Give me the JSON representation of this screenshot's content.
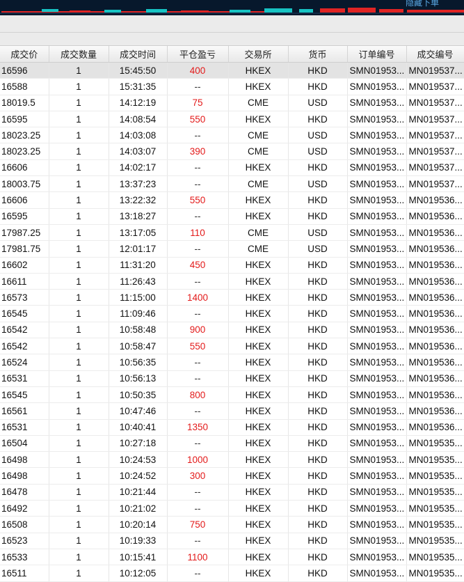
{
  "topbar": {
    "hide_label": "隐藏下单"
  },
  "table": {
    "headers": [
      "成交价",
      "成交数量",
      "成交时间",
      "平仓盈亏",
      "交易所",
      "货币",
      "订单编号",
      "成交编号"
    ],
    "rows": [
      {
        "price": "16596",
        "qty": "1",
        "time": "15:45:50",
        "pnl": "400",
        "exchange": "HKEX",
        "currency": "HKD",
        "order": "SMN01953...",
        "trade": "MN019537...",
        "selected": true
      },
      {
        "price": "16588",
        "qty": "1",
        "time": "15:31:35",
        "pnl": "--",
        "exchange": "HKEX",
        "currency": "HKD",
        "order": "SMN01953...",
        "trade": "MN019537..."
      },
      {
        "price": "18019.5",
        "qty": "1",
        "time": "14:12:19",
        "pnl": "75",
        "exchange": "CME",
        "currency": "USD",
        "order": "SMN01953...",
        "trade": "MN019537..."
      },
      {
        "price": "16595",
        "qty": "1",
        "time": "14:08:54",
        "pnl": "550",
        "exchange": "HKEX",
        "currency": "HKD",
        "order": "SMN01953...",
        "trade": "MN019537..."
      },
      {
        "price": "18023.25",
        "qty": "1",
        "time": "14:03:08",
        "pnl": "--",
        "exchange": "CME",
        "currency": "USD",
        "order": "SMN01953...",
        "trade": "MN019537..."
      },
      {
        "price": "18023.25",
        "qty": "1",
        "time": "14:03:07",
        "pnl": "390",
        "exchange": "CME",
        "currency": "USD",
        "order": "SMN01953...",
        "trade": "MN019537..."
      },
      {
        "price": "16606",
        "qty": "1",
        "time": "14:02:17",
        "pnl": "--",
        "exchange": "HKEX",
        "currency": "HKD",
        "order": "SMN01953...",
        "trade": "MN019537..."
      },
      {
        "price": "18003.75",
        "qty": "1",
        "time": "13:37:23",
        "pnl": "--",
        "exchange": "CME",
        "currency": "USD",
        "order": "SMN01953...",
        "trade": "MN019537..."
      },
      {
        "price": "16606",
        "qty": "1",
        "time": "13:22:32",
        "pnl": "550",
        "exchange": "HKEX",
        "currency": "HKD",
        "order": "SMN01953...",
        "trade": "MN019536..."
      },
      {
        "price": "16595",
        "qty": "1",
        "time": "13:18:27",
        "pnl": "--",
        "exchange": "HKEX",
        "currency": "HKD",
        "order": "SMN01953...",
        "trade": "MN019536..."
      },
      {
        "price": "17987.25",
        "qty": "1",
        "time": "13:17:05",
        "pnl": "110",
        "exchange": "CME",
        "currency": "USD",
        "order": "SMN01953...",
        "trade": "MN019536..."
      },
      {
        "price": "17981.75",
        "qty": "1",
        "time": "12:01:17",
        "pnl": "--",
        "exchange": "CME",
        "currency": "USD",
        "order": "SMN01953...",
        "trade": "MN019536..."
      },
      {
        "price": "16602",
        "qty": "1",
        "time": "11:31:20",
        "pnl": "450",
        "exchange": "HKEX",
        "currency": "HKD",
        "order": "SMN01953...",
        "trade": "MN019536..."
      },
      {
        "price": "16611",
        "qty": "1",
        "time": "11:26:43",
        "pnl": "--",
        "exchange": "HKEX",
        "currency": "HKD",
        "order": "SMN01953...",
        "trade": "MN019536..."
      },
      {
        "price": "16573",
        "qty": "1",
        "time": "11:15:00",
        "pnl": "1400",
        "exchange": "HKEX",
        "currency": "HKD",
        "order": "SMN01953...",
        "trade": "MN019536..."
      },
      {
        "price": "16545",
        "qty": "1",
        "time": "11:09:46",
        "pnl": "--",
        "exchange": "HKEX",
        "currency": "HKD",
        "order": "SMN01953...",
        "trade": "MN019536..."
      },
      {
        "price": "16542",
        "qty": "1",
        "time": "10:58:48",
        "pnl": "900",
        "exchange": "HKEX",
        "currency": "HKD",
        "order": "SMN01953...",
        "trade": "MN019536..."
      },
      {
        "price": "16542",
        "qty": "1",
        "time": "10:58:47",
        "pnl": "550",
        "exchange": "HKEX",
        "currency": "HKD",
        "order": "SMN01953...",
        "trade": "MN019536..."
      },
      {
        "price": "16524",
        "qty": "1",
        "time": "10:56:35",
        "pnl": "--",
        "exchange": "HKEX",
        "currency": "HKD",
        "order": "SMN01953...",
        "trade": "MN019536..."
      },
      {
        "price": "16531",
        "qty": "1",
        "time": "10:56:13",
        "pnl": "--",
        "exchange": "HKEX",
        "currency": "HKD",
        "order": "SMN01953...",
        "trade": "MN019536..."
      },
      {
        "price": "16545",
        "qty": "1",
        "time": "10:50:35",
        "pnl": "800",
        "exchange": "HKEX",
        "currency": "HKD",
        "order": "SMN01953...",
        "trade": "MN019536..."
      },
      {
        "price": "16561",
        "qty": "1",
        "time": "10:47:46",
        "pnl": "--",
        "exchange": "HKEX",
        "currency": "HKD",
        "order": "SMN01953...",
        "trade": "MN019536..."
      },
      {
        "price": "16531",
        "qty": "1",
        "time": "10:40:41",
        "pnl": "1350",
        "exchange": "HKEX",
        "currency": "HKD",
        "order": "SMN01953...",
        "trade": "MN019536..."
      },
      {
        "price": "16504",
        "qty": "1",
        "time": "10:27:18",
        "pnl": "--",
        "exchange": "HKEX",
        "currency": "HKD",
        "order": "SMN01953...",
        "trade": "MN019535..."
      },
      {
        "price": "16498",
        "qty": "1",
        "time": "10:24:53",
        "pnl": "1000",
        "exchange": "HKEX",
        "currency": "HKD",
        "order": "SMN01953...",
        "trade": "MN019535..."
      },
      {
        "price": "16498",
        "qty": "1",
        "time": "10:24:52",
        "pnl": "300",
        "exchange": "HKEX",
        "currency": "HKD",
        "order": "SMN01953...",
        "trade": "MN019535..."
      },
      {
        "price": "16478",
        "qty": "1",
        "time": "10:21:44",
        "pnl": "--",
        "exchange": "HKEX",
        "currency": "HKD",
        "order": "SMN01953...",
        "trade": "MN019535..."
      },
      {
        "price": "16492",
        "qty": "1",
        "time": "10:21:02",
        "pnl": "--",
        "exchange": "HKEX",
        "currency": "HKD",
        "order": "SMN01953...",
        "trade": "MN019535..."
      },
      {
        "price": "16508",
        "qty": "1",
        "time": "10:20:14",
        "pnl": "750",
        "exchange": "HKEX",
        "currency": "HKD",
        "order": "SMN01953...",
        "trade": "MN019535..."
      },
      {
        "price": "16523",
        "qty": "1",
        "time": "10:19:33",
        "pnl": "--",
        "exchange": "HKEX",
        "currency": "HKD",
        "order": "SMN01953...",
        "trade": "MN019535..."
      },
      {
        "price": "16533",
        "qty": "1",
        "time": "10:15:41",
        "pnl": "1100",
        "exchange": "HKEX",
        "currency": "HKD",
        "order": "SMN01953...",
        "trade": "MN019535..."
      },
      {
        "price": "16511",
        "qty": "1",
        "time": "10:12:05",
        "pnl": "--",
        "exchange": "HKEX",
        "currency": "HKD",
        "order": "SMN01953...",
        "trade": "MN019535..."
      }
    ]
  },
  "colors": {
    "profit": "#e31a1a",
    "topbar_bg": "#07182c",
    "bars_up": "#e02424",
    "bars_down": "#17c3c3"
  }
}
